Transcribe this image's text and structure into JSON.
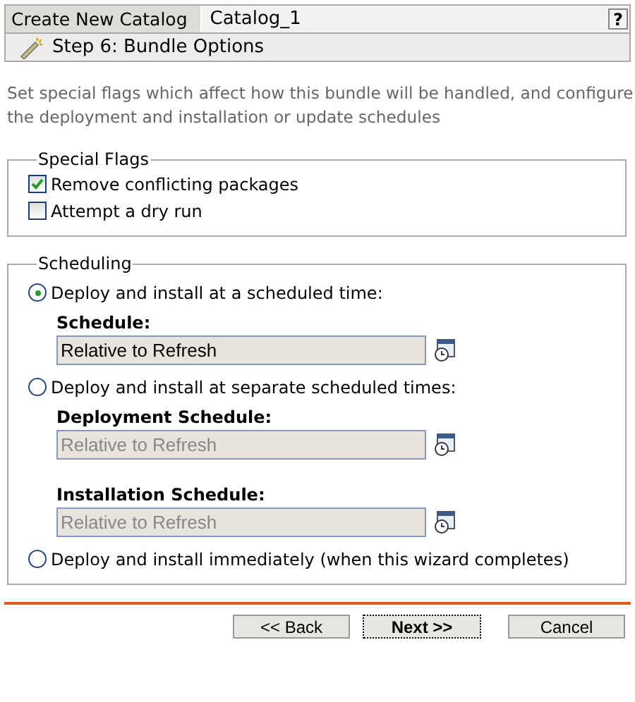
{
  "header": {
    "tab": "Create New Catalog",
    "name": "Catalog_1",
    "help": "?"
  },
  "step": {
    "title": "Step 6: Bundle Options"
  },
  "description": "Set special flags which affect how this bundle will be handled, and configure the deployment and installation or update schedules",
  "special_flags": {
    "legend": "Special Flags",
    "items": [
      {
        "label": "Remove conflicting packages",
        "checked": true
      },
      {
        "label": "Attempt a dry run",
        "checked": false
      }
    ]
  },
  "scheduling": {
    "legend": "Scheduling",
    "options": [
      {
        "label": "Deploy and install at a scheduled time:",
        "selected": true,
        "schedules": [
          {
            "label": "Schedule:",
            "value": "Relative to Refresh",
            "disabled": false
          }
        ]
      },
      {
        "label": "Deploy and install at separate scheduled times:",
        "selected": false,
        "schedules": [
          {
            "label": "Deployment Schedule:",
            "value": "Relative to Refresh",
            "disabled": true
          },
          {
            "label": "Installation Schedule:",
            "value": "Relative to Refresh",
            "disabled": true
          }
        ]
      },
      {
        "label": "Deploy and install immediately (when this wizard completes)",
        "selected": false
      }
    ]
  },
  "buttons": [
    {
      "label": "<< Back",
      "focused": false
    },
    {
      "label": "Next >>",
      "focused": true
    },
    {
      "label": "Cancel",
      "focused": false
    }
  ]
}
